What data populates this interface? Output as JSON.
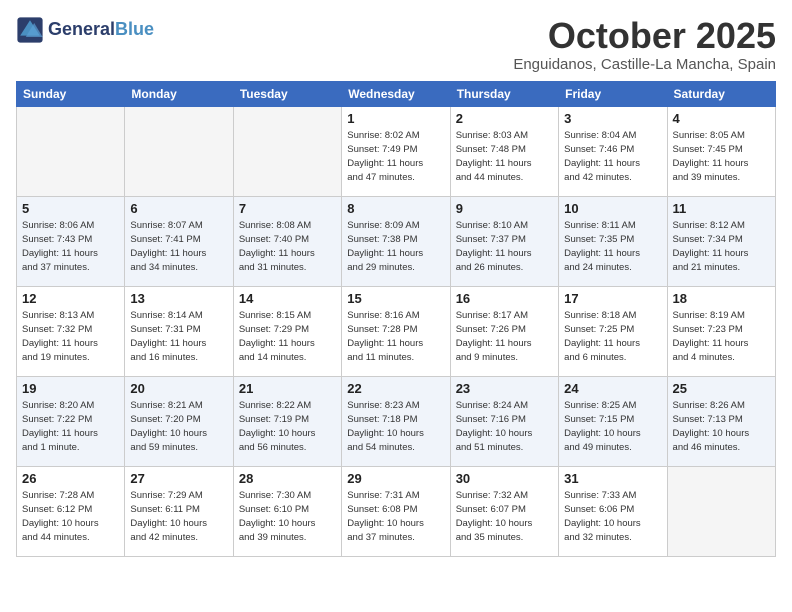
{
  "header": {
    "logo_line1": "General",
    "logo_line2": "Blue",
    "month": "October 2025",
    "location": "Enguidanos, Castille-La Mancha, Spain"
  },
  "weekdays": [
    "Sunday",
    "Monday",
    "Tuesday",
    "Wednesday",
    "Thursday",
    "Friday",
    "Saturday"
  ],
  "weeks": [
    [
      {
        "day": "",
        "detail": ""
      },
      {
        "day": "",
        "detail": ""
      },
      {
        "day": "",
        "detail": ""
      },
      {
        "day": "1",
        "detail": "Sunrise: 8:02 AM\nSunset: 7:49 PM\nDaylight: 11 hours\nand 47 minutes."
      },
      {
        "day": "2",
        "detail": "Sunrise: 8:03 AM\nSunset: 7:48 PM\nDaylight: 11 hours\nand 44 minutes."
      },
      {
        "day": "3",
        "detail": "Sunrise: 8:04 AM\nSunset: 7:46 PM\nDaylight: 11 hours\nand 42 minutes."
      },
      {
        "day": "4",
        "detail": "Sunrise: 8:05 AM\nSunset: 7:45 PM\nDaylight: 11 hours\nand 39 minutes."
      }
    ],
    [
      {
        "day": "5",
        "detail": "Sunrise: 8:06 AM\nSunset: 7:43 PM\nDaylight: 11 hours\nand 37 minutes."
      },
      {
        "day": "6",
        "detail": "Sunrise: 8:07 AM\nSunset: 7:41 PM\nDaylight: 11 hours\nand 34 minutes."
      },
      {
        "day": "7",
        "detail": "Sunrise: 8:08 AM\nSunset: 7:40 PM\nDaylight: 11 hours\nand 31 minutes."
      },
      {
        "day": "8",
        "detail": "Sunrise: 8:09 AM\nSunset: 7:38 PM\nDaylight: 11 hours\nand 29 minutes."
      },
      {
        "day": "9",
        "detail": "Sunrise: 8:10 AM\nSunset: 7:37 PM\nDaylight: 11 hours\nand 26 minutes."
      },
      {
        "day": "10",
        "detail": "Sunrise: 8:11 AM\nSunset: 7:35 PM\nDaylight: 11 hours\nand 24 minutes."
      },
      {
        "day": "11",
        "detail": "Sunrise: 8:12 AM\nSunset: 7:34 PM\nDaylight: 11 hours\nand 21 minutes."
      }
    ],
    [
      {
        "day": "12",
        "detail": "Sunrise: 8:13 AM\nSunset: 7:32 PM\nDaylight: 11 hours\nand 19 minutes."
      },
      {
        "day": "13",
        "detail": "Sunrise: 8:14 AM\nSunset: 7:31 PM\nDaylight: 11 hours\nand 16 minutes."
      },
      {
        "day": "14",
        "detail": "Sunrise: 8:15 AM\nSunset: 7:29 PM\nDaylight: 11 hours\nand 14 minutes."
      },
      {
        "day": "15",
        "detail": "Sunrise: 8:16 AM\nSunset: 7:28 PM\nDaylight: 11 hours\nand 11 minutes."
      },
      {
        "day": "16",
        "detail": "Sunrise: 8:17 AM\nSunset: 7:26 PM\nDaylight: 11 hours\nand 9 minutes."
      },
      {
        "day": "17",
        "detail": "Sunrise: 8:18 AM\nSunset: 7:25 PM\nDaylight: 11 hours\nand 6 minutes."
      },
      {
        "day": "18",
        "detail": "Sunrise: 8:19 AM\nSunset: 7:23 PM\nDaylight: 11 hours\nand 4 minutes."
      }
    ],
    [
      {
        "day": "19",
        "detail": "Sunrise: 8:20 AM\nSunset: 7:22 PM\nDaylight: 11 hours\nand 1 minute."
      },
      {
        "day": "20",
        "detail": "Sunrise: 8:21 AM\nSunset: 7:20 PM\nDaylight: 10 hours\nand 59 minutes."
      },
      {
        "day": "21",
        "detail": "Sunrise: 8:22 AM\nSunset: 7:19 PM\nDaylight: 10 hours\nand 56 minutes."
      },
      {
        "day": "22",
        "detail": "Sunrise: 8:23 AM\nSunset: 7:18 PM\nDaylight: 10 hours\nand 54 minutes."
      },
      {
        "day": "23",
        "detail": "Sunrise: 8:24 AM\nSunset: 7:16 PM\nDaylight: 10 hours\nand 51 minutes."
      },
      {
        "day": "24",
        "detail": "Sunrise: 8:25 AM\nSunset: 7:15 PM\nDaylight: 10 hours\nand 49 minutes."
      },
      {
        "day": "25",
        "detail": "Sunrise: 8:26 AM\nSunset: 7:13 PM\nDaylight: 10 hours\nand 46 minutes."
      }
    ],
    [
      {
        "day": "26",
        "detail": "Sunrise: 7:28 AM\nSunset: 6:12 PM\nDaylight: 10 hours\nand 44 minutes."
      },
      {
        "day": "27",
        "detail": "Sunrise: 7:29 AM\nSunset: 6:11 PM\nDaylight: 10 hours\nand 42 minutes."
      },
      {
        "day": "28",
        "detail": "Sunrise: 7:30 AM\nSunset: 6:10 PM\nDaylight: 10 hours\nand 39 minutes."
      },
      {
        "day": "29",
        "detail": "Sunrise: 7:31 AM\nSunset: 6:08 PM\nDaylight: 10 hours\nand 37 minutes."
      },
      {
        "day": "30",
        "detail": "Sunrise: 7:32 AM\nSunset: 6:07 PM\nDaylight: 10 hours\nand 35 minutes."
      },
      {
        "day": "31",
        "detail": "Sunrise: 7:33 AM\nSunset: 6:06 PM\nDaylight: 10 hours\nand 32 minutes."
      },
      {
        "day": "",
        "detail": ""
      }
    ]
  ]
}
